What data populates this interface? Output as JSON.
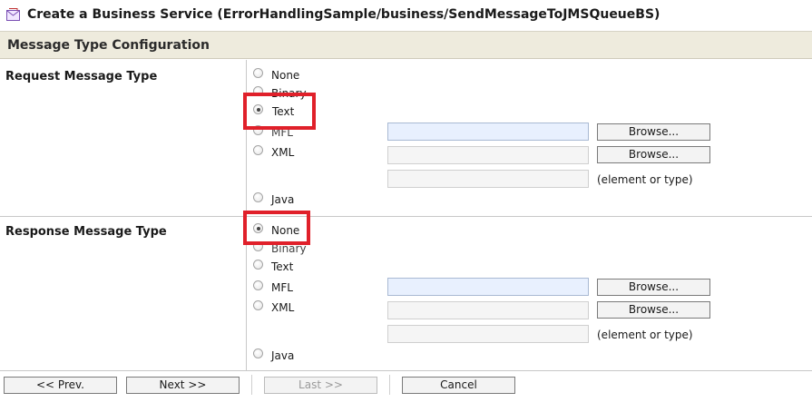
{
  "window": {
    "title": "Create a Business Service (ErrorHandlingSample/business/SendMessageToJMSQueueBS)",
    "icon": "business-service-icon"
  },
  "section": {
    "title": "Message Type Configuration"
  },
  "request": {
    "label": "Request Message Type",
    "selected": "Text",
    "options": {
      "none": "None",
      "binary": "Binary",
      "text": "Text",
      "mfl": "MFL",
      "xml": "XML",
      "java": "Java"
    },
    "mfl_value": "",
    "xml_value": "",
    "element_value": "",
    "browse_label": "Browse...",
    "element_hint": "(element or type)"
  },
  "response": {
    "label": "Response Message Type",
    "selected": "None",
    "options": {
      "none": "None",
      "binary": "Binary",
      "text": "Text",
      "mfl": "MFL",
      "xml": "XML",
      "java": "Java"
    },
    "mfl_value": "",
    "xml_value": "",
    "element_value": "",
    "browse_label": "Browse...",
    "element_hint": "(element or type)"
  },
  "nav": {
    "prev": "<< Prev.",
    "next": "Next >>",
    "last": "Last >>",
    "cancel": "Cancel"
  },
  "colors": {
    "highlight": "#e0202a",
    "section_bg": "#eeebdd"
  }
}
